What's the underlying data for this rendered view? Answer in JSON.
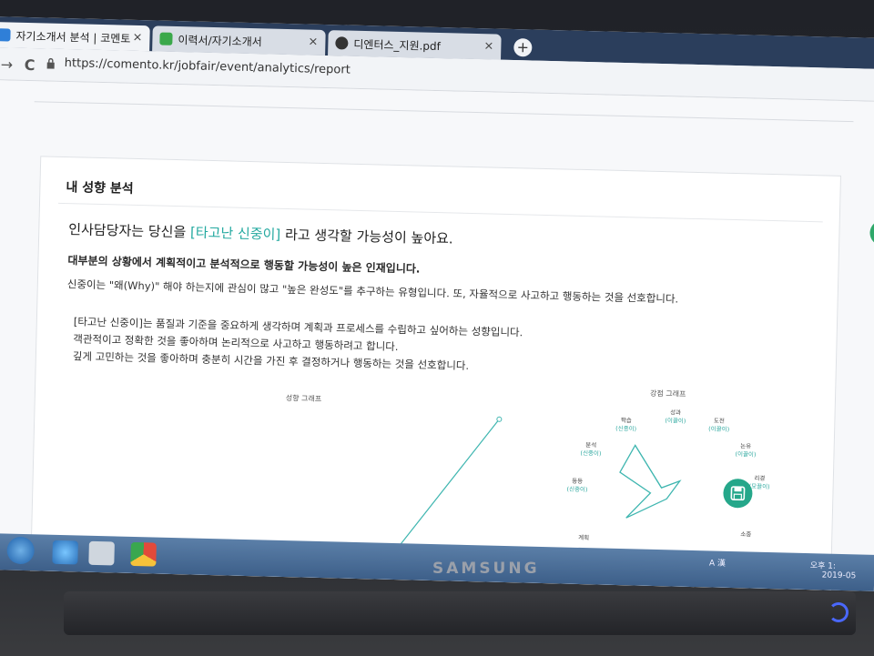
{
  "browser": {
    "tabs": [
      {
        "label": "자기소개서 분석 | 코멘토",
        "close": "×"
      },
      {
        "label": "이력서/자기소개서",
        "close": "×"
      },
      {
        "label": "디엔터스_지원.pdf",
        "close": "×"
      }
    ],
    "new_tab": "+",
    "url": "https://comento.kr/jobfair/event/analytics/report",
    "nav": {
      "back": "→",
      "reload": "C"
    }
  },
  "card": {
    "title": "내 성향 분석",
    "headline_prefix": "인사담당자는 당신을",
    "headline_highlight": "[타고난 신중이]",
    "headline_suffix": "라고 생각할 가능성이 높아요.",
    "bold_line": "대부분의 상황에서 계획적이고 분석적으로 행동할 가능성이 높은 인재입니다.",
    "paragraph1": "신중이는 \"왜(Why)\" 해야 하는지에 관심이 많고 \"높은 완성도\"를 추구하는 유형입니다. 또, 자율적으로 사고하고 행동하는 것을 선호합니다.",
    "paragraph2": [
      "[타고난 신중이]는 품질과 기준을 중요하게 생각하며 계획과 프로세스를 수립하고 싶어하는 성향입니다.",
      "객관적이고 정확한 것을 좋아하며 논리적으로 사고하고 행동하려고 합니다.",
      "깊게 고민하는 것을 좋아하며 충분히 시간을 가진 후 결정하거나 행동하는 것을 선호합니다."
    ],
    "graph1_label": "성향 그래프",
    "graph2_label": "강점 그래프",
    "traits": [
      {
        "name": "성과",
        "sub": "(이끌이)"
      },
      {
        "name": "학습",
        "sub": "(신중이)"
      },
      {
        "name": "도전",
        "sub": "(이끌이)"
      },
      {
        "name": "분석",
        "sub": "(신중이)"
      },
      {
        "name": "논유",
        "sub": "(이끌이)"
      },
      {
        "name": "동등",
        "sub": "(신중이)"
      },
      {
        "name": "리경",
        "sub": "(모끌이)"
      },
      {
        "name": "계획",
        "sub": ""
      },
      {
        "name": "소중",
        "sub": ""
      }
    ]
  },
  "taskbar": {
    "tray_time": "오후 1:",
    "tray_date": "2019-05",
    "tray_lang": "A 漢"
  },
  "brand": "SAMSUNG",
  "colors": {
    "accent": "#24a9a0",
    "tab_bar": "#2b3e5c",
    "save_button": "#25a78a"
  }
}
